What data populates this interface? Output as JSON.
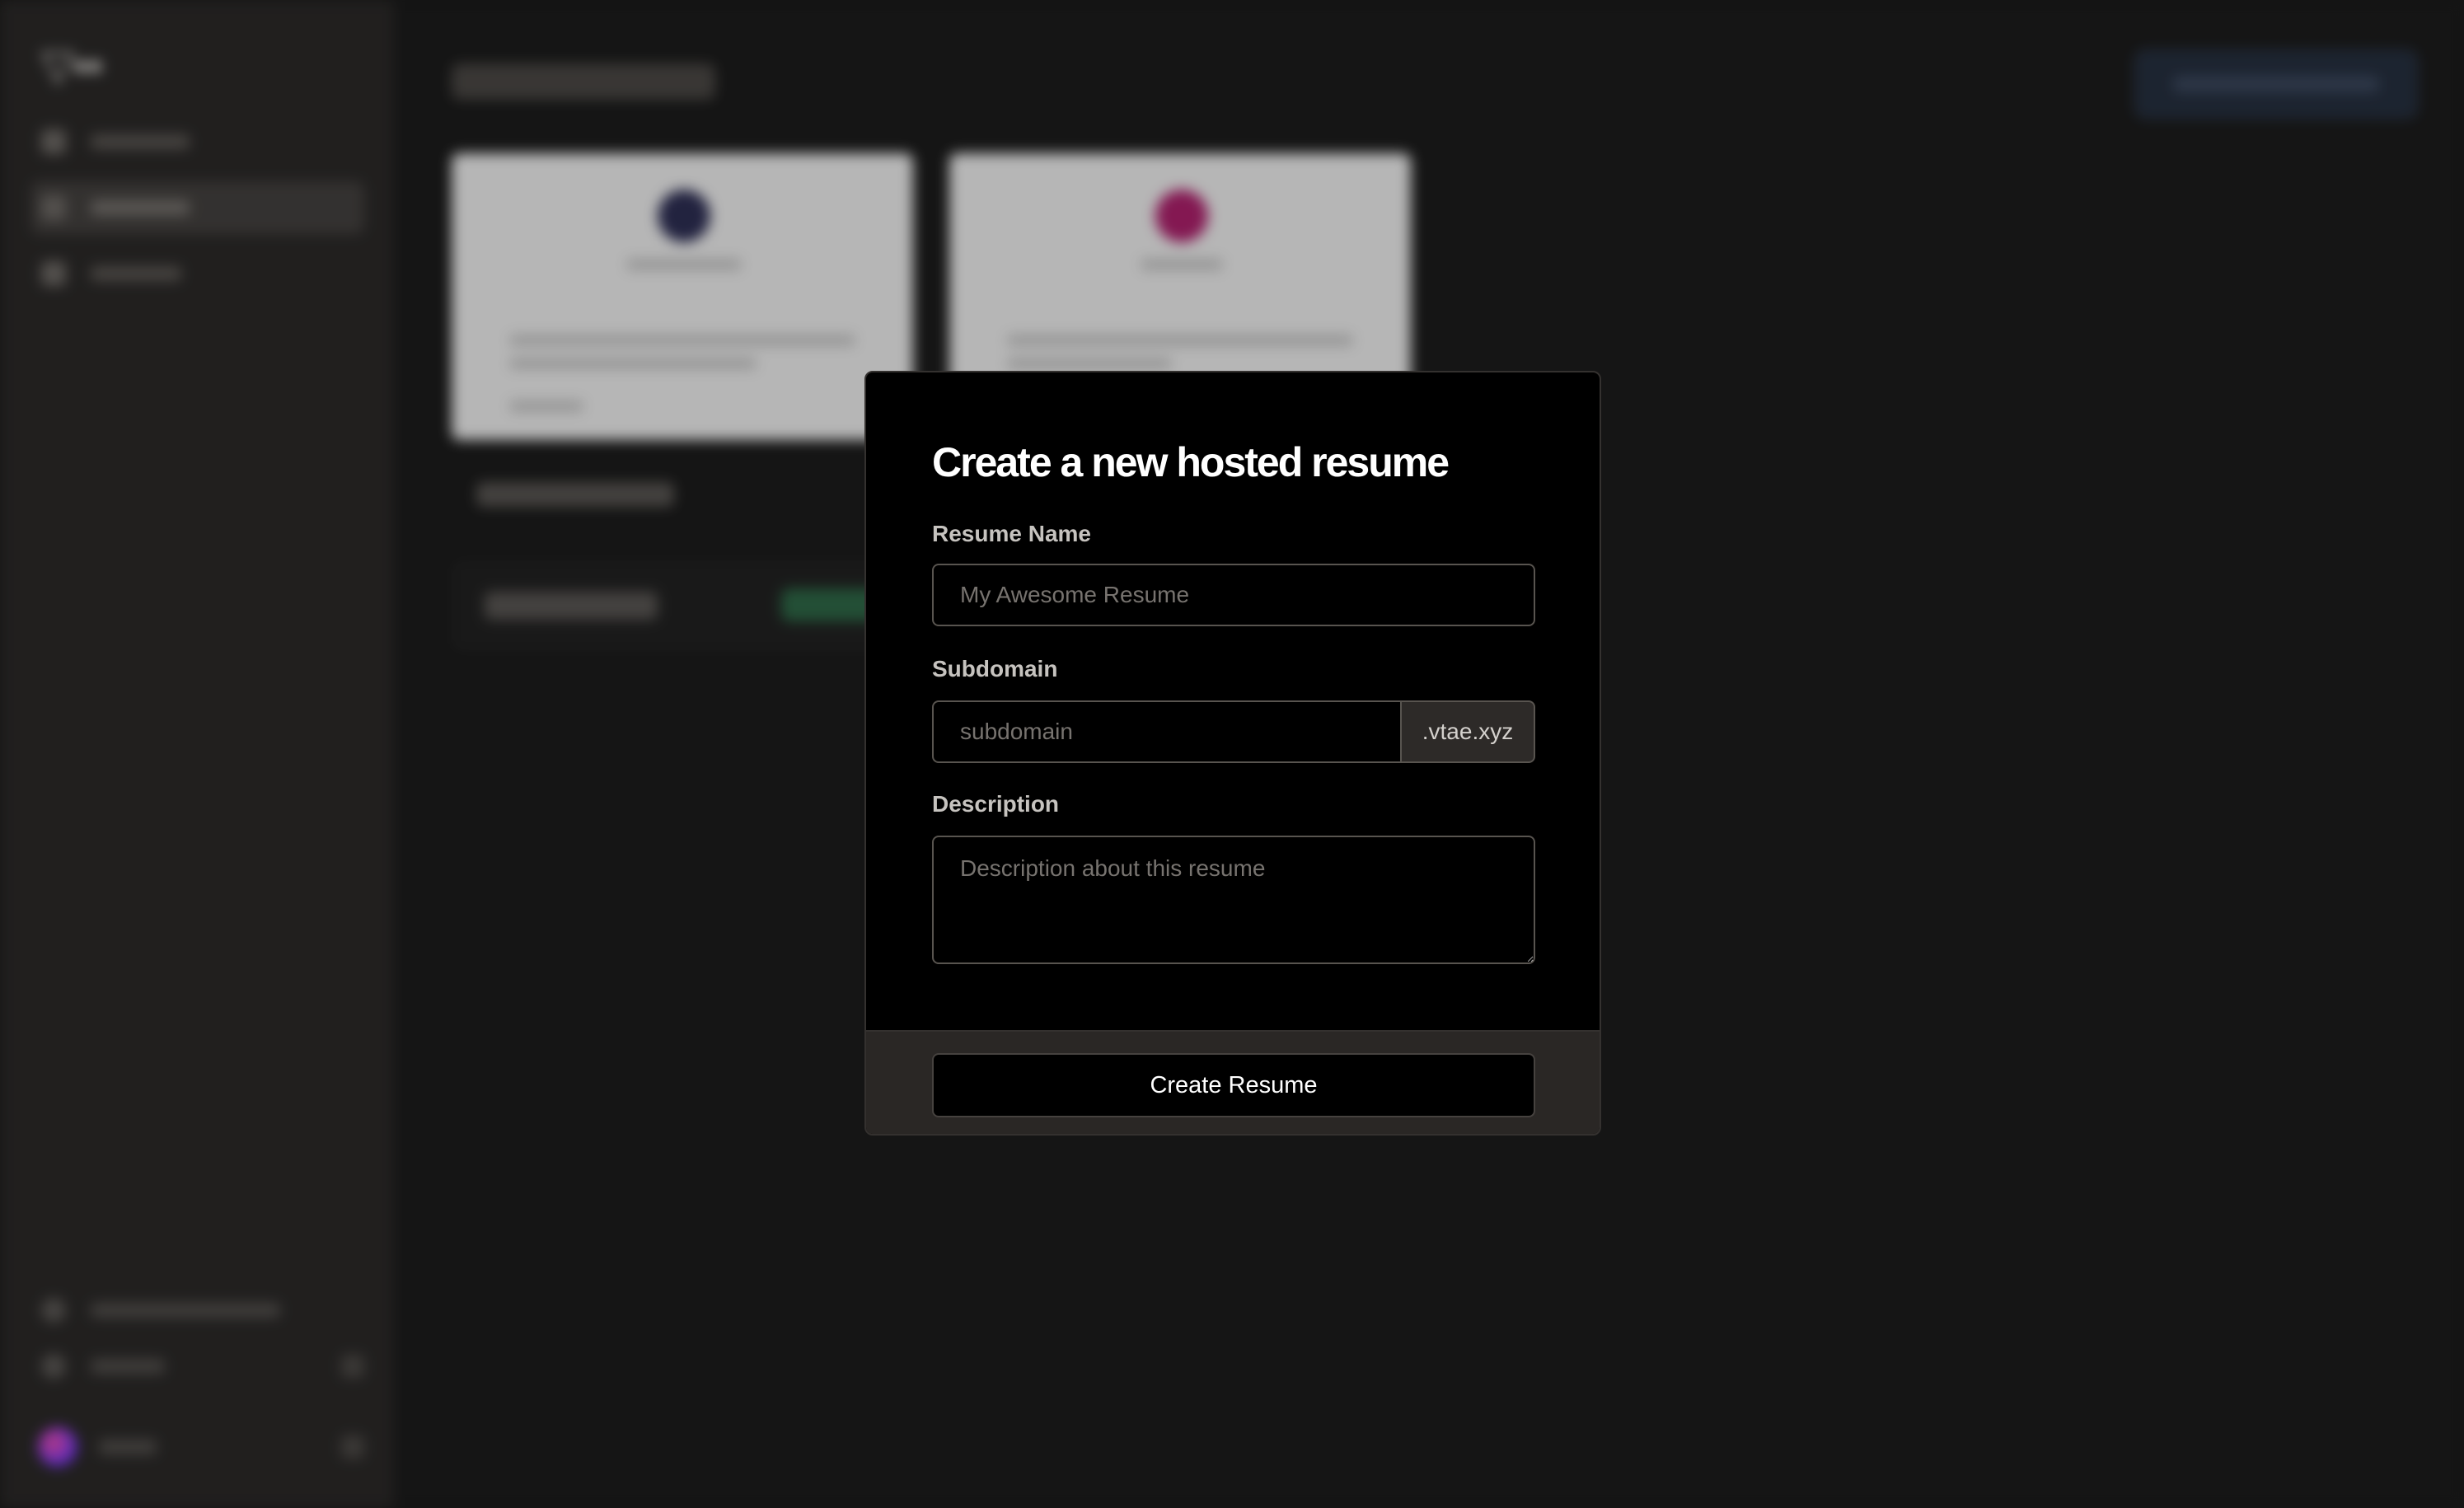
{
  "modal": {
    "title": "Create a new hosted resume",
    "resume_name": {
      "label": "Resume Name",
      "placeholder": "My Awesome Resume",
      "value": ""
    },
    "subdomain": {
      "label": "Subdomain",
      "placeholder": "subdomain",
      "suffix": ".vtae.xyz",
      "value": ""
    },
    "description": {
      "label": "Description",
      "placeholder": "Description about this resume",
      "value": ""
    },
    "submit_label": "Create Resume"
  },
  "background": {
    "note": "Background application content is blurred behind the modal and not legible."
  },
  "colors": {
    "modal_bg": "#000000",
    "footer_bg": "#2a2725",
    "sidebar_bg": "#2c2a29",
    "page_bg": "#1c1c1c"
  }
}
